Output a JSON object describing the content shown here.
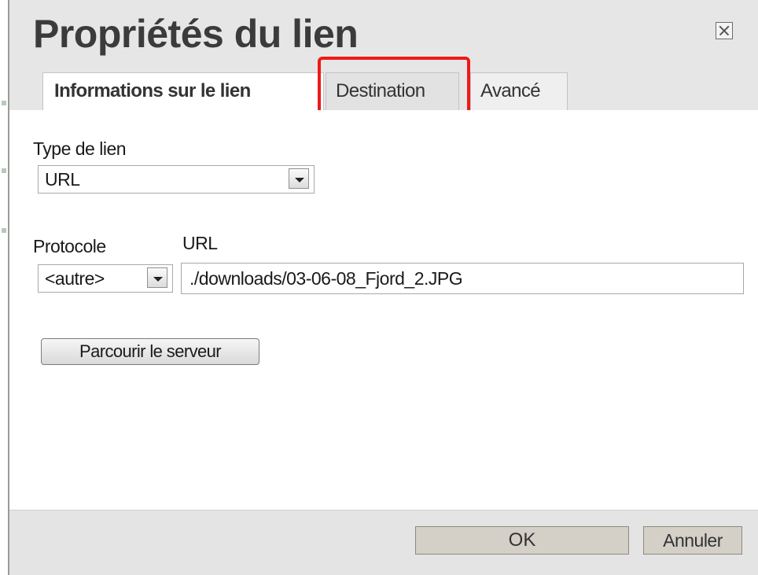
{
  "dialog": {
    "title": "Propriétés du lien",
    "close_icon": "close-icon"
  },
  "tabs": [
    {
      "label": "Informations sur le lien",
      "active": true
    },
    {
      "label": "Destination",
      "active": false,
      "highlighted": true
    },
    {
      "label": "Avancé",
      "active": false
    }
  ],
  "link_type": {
    "label": "Type de lien",
    "value": "URL"
  },
  "protocol": {
    "label": "Protocole",
    "value": "<autre>"
  },
  "url": {
    "label": "URL",
    "value": "./downloads/03-06-08_Fjord_2.JPG"
  },
  "buttons": {
    "browse": "Parcourir le serveur",
    "ok": "OK",
    "cancel": "Annuler"
  },
  "colors": {
    "highlight": "#f01818",
    "header_bg": "#e6e6e6",
    "footer_bg": "#e4e4e4"
  }
}
